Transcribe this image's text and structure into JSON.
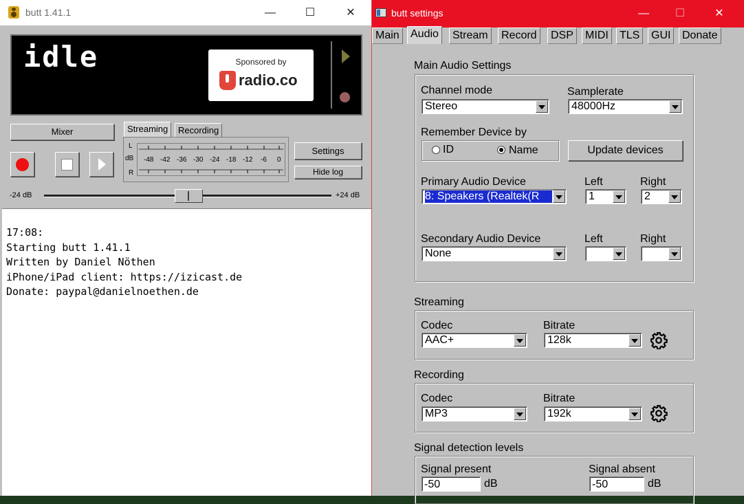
{
  "main_window": {
    "title": "butt 1.41.1",
    "caption_minimize": "—",
    "caption_maximize": "☐",
    "caption_close": "✕",
    "status_display": "idle",
    "sponsor_text": "Sponsored by",
    "sponsor_brand": "radio.co",
    "mixer_label": "Mixer",
    "settings_label": "Settings",
    "hide_log_label": "Hide log",
    "tabs": [
      "Streaming",
      "Recording"
    ],
    "vu_left_label": "L",
    "vu_db_label": "dB",
    "vu_right_label": "R",
    "vu_scale": [
      "-48",
      "-42",
      "-36",
      "-30",
      "-24",
      "-18",
      "-12",
      "-6",
      "0"
    ],
    "gain_min": "-24 dB",
    "gain_max": "+24 dB",
    "log_lines": [
      "17:08:",
      "Starting butt 1.41.1",
      "Written by Daniel Nöthen",
      "iPhone/iPad client: https://izicast.de",
      "Donate: paypal@danielnoethen.de"
    ]
  },
  "settings_window": {
    "title": "butt settings",
    "caption_minimize": "—",
    "caption_maximize": "☐",
    "caption_close": "✕",
    "tabs": [
      "Main",
      "Audio",
      "Stream",
      "Record",
      "DSP",
      "MIDI",
      "TLS",
      "GUI",
      "Donate"
    ],
    "active_tab": "Audio",
    "main_audio": {
      "group_label": "Main Audio Settings",
      "channel_mode_label": "Channel mode",
      "channel_mode_value": "Stereo",
      "samplerate_label": "Samplerate",
      "samplerate_value": "48000Hz",
      "remember_label": "Remember Device by",
      "radio_id": "ID",
      "radio_name": "Name",
      "update_devices": "Update devices",
      "primary_label": "Primary Audio Device",
      "primary_value": "8: Speakers (Realtek(R",
      "primary_left_label": "Left",
      "primary_left_value": "1",
      "primary_right_label": "Right",
      "primary_right_value": "2",
      "secondary_label": "Secondary Audio Device",
      "secondary_value": "None",
      "secondary_left_label": "Left",
      "secondary_left_value": "",
      "secondary_right_label": "Right",
      "secondary_right_value": ""
    },
    "streaming": {
      "group_label": "Streaming",
      "codec_label": "Codec",
      "codec_value": "AAC+",
      "bitrate_label": "Bitrate",
      "bitrate_value": "128k"
    },
    "recording": {
      "group_label": "Recording",
      "codec_label": "Codec",
      "codec_value": "MP3",
      "bitrate_label": "Bitrate",
      "bitrate_value": "192k"
    },
    "signal": {
      "group_label": "Signal detection levels",
      "present_label": "Signal present",
      "present_value": "-50",
      "present_unit": "dB",
      "absent_label": "Signal absent",
      "absent_value": "-50",
      "absent_unit": "dB"
    }
  }
}
